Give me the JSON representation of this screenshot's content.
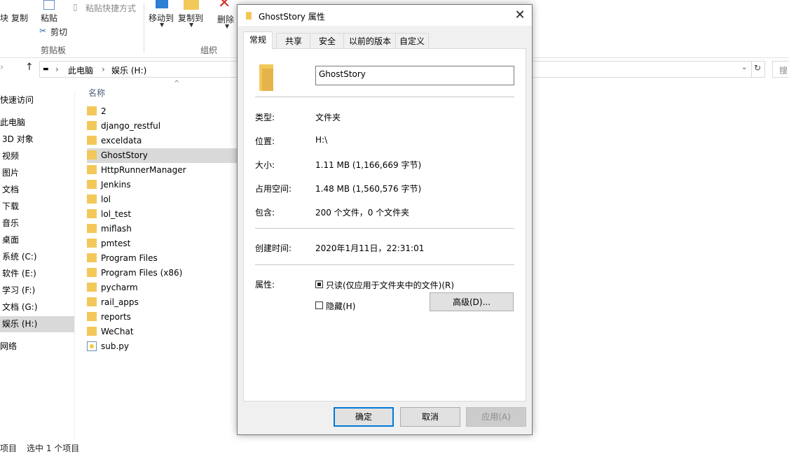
{
  "explorer": {
    "ribbon": {
      "pin_label": "块",
      "copy_label": "复制",
      "paste_label": "粘贴",
      "paste_shortcut_label": "粘贴快捷方式",
      "cut_label": "剪切",
      "clipboard_group": "剪贴板",
      "move_to_label": "移动到",
      "copy_to_label": "复制到",
      "delete_label": "删除",
      "organize_group": "组织"
    },
    "address": {
      "path_root": "此电脑",
      "path_drive": "娱乐 (H:)",
      "search_placeholder": "搜"
    },
    "nav_items": [
      "快速访问",
      "此电脑",
      "3D 对象",
      "视频",
      "图片",
      "文档",
      "下载",
      "音乐",
      "桌面",
      "系统 (C:)",
      "软件 (E:)",
      "学习 (F:)",
      "文档 (G:)",
      "娱乐 (H:)",
      "网络"
    ],
    "column_header": "名称",
    "files": [
      "2",
      "django_restful",
      "exceldata",
      "GhostStory",
      "HttpRunnerManager",
      "Jenkins",
      "lol",
      "lol_test",
      "miflash",
      "pmtest",
      "Program Files",
      "Program Files (x86)",
      "pycharm",
      "rail_apps",
      "reports",
      "WeChat",
      "sub.py"
    ],
    "status": {
      "items": "项目",
      "selected": "选中 1 个项目"
    }
  },
  "dialog": {
    "title": "GhostStory 属性",
    "tabs": [
      "常规",
      "共享",
      "安全",
      "以前的版本",
      "自定义"
    ],
    "name_value": "GhostStory",
    "type_label": "类型:",
    "type_value": "文件夹",
    "location_label": "位置:",
    "location_value": "H:\\",
    "size_label": "大小:",
    "size_value": "1.11 MB (1,166,669 字节)",
    "disk_label": "占用空间:",
    "disk_value": "1.48 MB (1,560,576 字节)",
    "contains_label": "包含:",
    "contains_value": "200 个文件，0 个文件夹",
    "created_label": "创建时间:",
    "created_value": "2020年1月11日，22:31:01",
    "attributes_label": "属性:",
    "readonly_label": "只读(仅应用于文件夹中的文件)(R)",
    "hidden_label": "隐藏(H)",
    "advanced_button": "高级(D)...",
    "ok_button": "确定",
    "cancel_button": "取消",
    "apply_button": "应用(A)"
  }
}
